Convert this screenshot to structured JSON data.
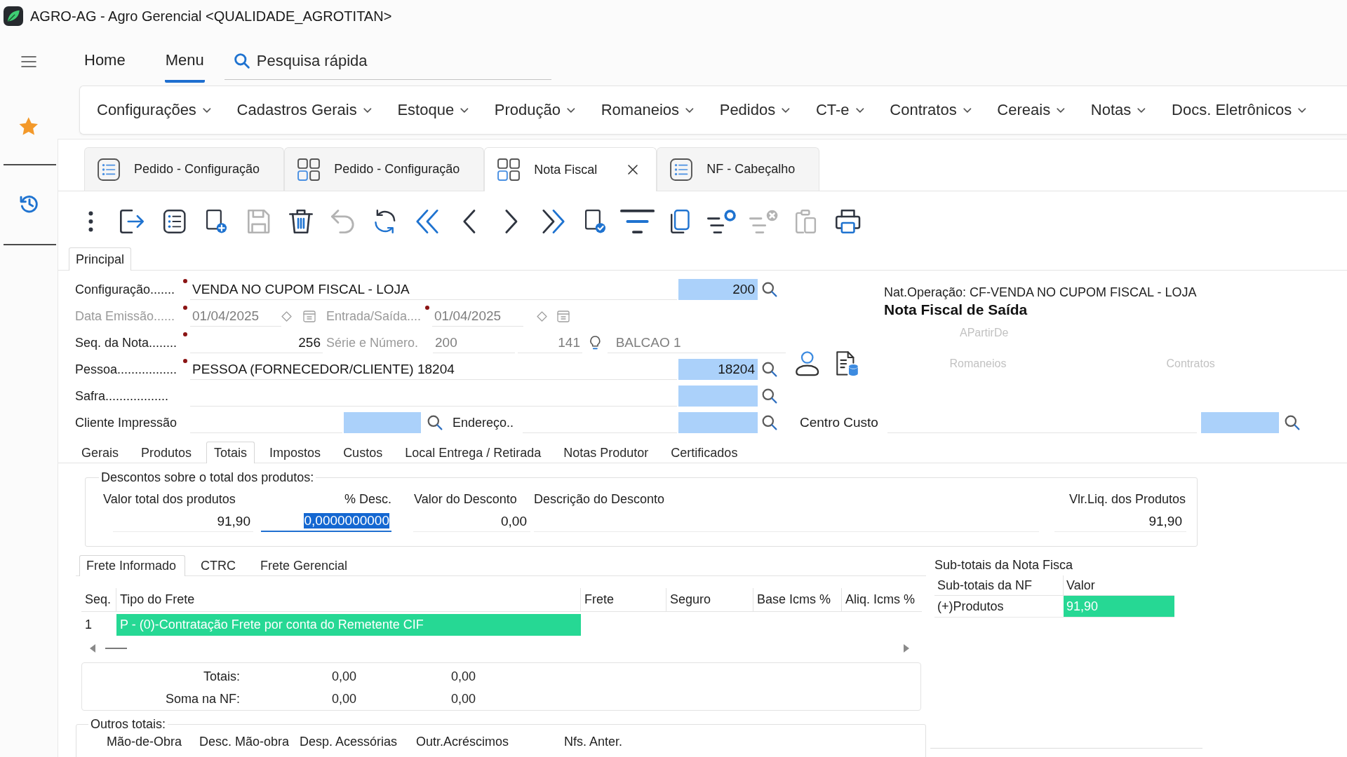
{
  "window": {
    "title": "AGRO-AG - Agro Gerencial <QUALIDADE_AGROTITAN>"
  },
  "top_nav": {
    "tabs": [
      {
        "label": "Home",
        "selected": false
      },
      {
        "label": "Menu",
        "selected": true
      }
    ],
    "search": {
      "placeholder": "Pesquisa rápida"
    }
  },
  "menu_bar": {
    "items": [
      "Configurações",
      "Cadastros Gerais",
      "Estoque",
      "Produção",
      "Romaneios",
      "Pedidos",
      "CT-e",
      "Contratos",
      "Cereais",
      "Notas",
      "Docs. Eletrônicos"
    ]
  },
  "document_tabs": [
    {
      "label": "Pedido - Configuração",
      "kind": "list",
      "selected": false
    },
    {
      "label": "Pedido - Configuração",
      "kind": "grid",
      "selected": false
    },
    {
      "label": "Nota Fiscal",
      "kind": "grid",
      "selected": true
    },
    {
      "label": "NF - Cabeçalho",
      "kind": "list",
      "selected": false
    }
  ],
  "toolbar": [
    {
      "kind": "more",
      "disabled": false
    },
    {
      "kind": "exit",
      "disabled": false
    },
    {
      "kind": "list",
      "disabled": false
    },
    {
      "kind": "new",
      "disabled": false
    },
    {
      "kind": "save",
      "disabled": true
    },
    {
      "kind": "delete",
      "disabled": false
    },
    {
      "kind": "undo",
      "disabled": true
    },
    {
      "kind": "refresh",
      "disabled": false
    },
    {
      "kind": "first",
      "disabled": false
    },
    {
      "kind": "previous",
      "disabled": false
    },
    {
      "kind": "next",
      "disabled": false
    },
    {
      "kind": "last",
      "disabled": false
    },
    {
      "kind": "confirm",
      "disabled": false
    },
    {
      "kind": "filter",
      "disabled": false
    },
    {
      "kind": "copy",
      "disabled": false
    },
    {
      "kind": "filter_settings",
      "disabled": false
    },
    {
      "kind": "filter_clear",
      "disabled": true
    },
    {
      "kind": "paste",
      "disabled": true
    },
    {
      "kind": "print",
      "disabled": false
    }
  ],
  "form": {
    "section_tabs": [
      {
        "label": "Principal",
        "selected": true
      }
    ],
    "rows": [
      {
        "kind": "lookup",
        "label": "Configuração.......",
        "required": true,
        "disabled": false,
        "value": "VENDA NO CUPOM FISCAL - LOJA",
        "code": "200"
      },
      {
        "kind": "dates",
        "fields": [
          {
            "label": "Data Emissão......",
            "required": true,
            "disabled": true,
            "value": "01/04/2025"
          },
          {
            "label": "Entrada/Saída....",
            "required": true,
            "disabled": true,
            "value": "01/04/2025"
          }
        ]
      },
      {
        "kind": "numbering",
        "label": "Seq. da Nota........",
        "required": true,
        "disabled": false,
        "value": "256",
        "series": {
          "label": "Série e Número.",
          "disabled": true,
          "serie": "200",
          "numero": "141"
        },
        "terminal": "BALCAO 1"
      },
      {
        "kind": "lookup",
        "label": "Pessoa.................",
        "required": true,
        "disabled": false,
        "value": "PESSOA (FORNECEDOR/CLIENTE) 18204",
        "code": "18204"
      },
      {
        "kind": "lookup",
        "label": "Safra..................",
        "required": false,
        "disabled": false
      },
      {
        "kind": "double_lookup",
        "label": "Cliente Impressão",
        "required": false,
        "disabled": false,
        "address": {
          "label": "Endereço..",
          "required": false
        }
      }
    ],
    "summary": {
      "operation": "Nat.Operação: CF-VENDA NO CUPOM FISCAL - LOJA",
      "document_type": "Nota Fiscal de Saída",
      "links": [
        {
          "label": "APartirDe",
          "disabled": true
        },
        {
          "label": "Romaneios",
          "disabled": true
        },
        {
          "label": "Contratos",
          "disabled": true
        }
      ],
      "cost_center": {
        "label": "Centro Custo"
      }
    }
  },
  "detail_tabs": [
    {
      "label": "Gerais",
      "selected": false
    },
    {
      "label": "Produtos",
      "selected": false
    },
    {
      "label": "Totais",
      "selected": true
    },
    {
      "label": "Impostos",
      "selected": false
    },
    {
      "label": "Custos",
      "selected": false
    },
    {
      "label": "Local Entrega / Retirada",
      "selected": false
    },
    {
      "label": "Notas Produtor",
      "selected": false
    },
    {
      "label": "Certificados",
      "selected": false
    }
  ],
  "totals_tab": {
    "discounts": {
      "title": "Descontos sobre o total dos produtos:",
      "product_total": {
        "label": "Valor total dos produtos",
        "value": "91,90"
      },
      "discount_percent": {
        "label": "% Desc.",
        "value": "0,0000000000",
        "focused": true
      },
      "discount_value": {
        "label": "Valor do Desconto",
        "value": "0,00"
      },
      "description": {
        "label": "Descrição do Desconto"
      },
      "net_total": {
        "label": "Vlr.Liq. dos Produtos",
        "value": "91,90"
      }
    },
    "freight": {
      "tabs": [
        {
          "label": "Frete Informado",
          "selected": true
        },
        {
          "label": "CTRC",
          "selected": false
        },
        {
          "label": "Frete Gerencial",
          "selected": false
        }
      ],
      "table": {
        "columns": [
          "Seq.",
          "Tipo do Frete",
          "Frete",
          "Seguro",
          "Base Icms %",
          "Aliq. Icms %"
        ],
        "rows": [
          {
            "cells": [
              {
                "text": "1",
                "selected": false
              },
              {
                "text": "P - (0)-Contratação Frete por conta do Remetente CIF",
                "selected": true
              }
            ]
          }
        ]
      },
      "totals": [
        {
          "label": "Totais:",
          "values": [
            "0,00",
            "0,00"
          ]
        },
        {
          "label": "Soma na NF:",
          "values": [
            "0,00",
            "0,00"
          ]
        }
      ]
    },
    "other_totals": {
      "title": "Outros totais:",
      "columns": [
        "Mão-de-Obra",
        "Desc. Mão-obra",
        "Desp. Acessórias",
        "Outr.Acréscimos",
        "Nfs. Anter."
      ]
    },
    "subtotals": {
      "title": "Sub-totais da Nota Fisca",
      "columns": [
        "Sub-totais da NF",
        "Valor"
      ],
      "rows": [
        {
          "cells": [
            {
              "text": "(+)Produtos",
              "selected": false
            },
            {
              "text": "91,90",
              "selected": true
            }
          ]
        }
      ]
    }
  }
}
